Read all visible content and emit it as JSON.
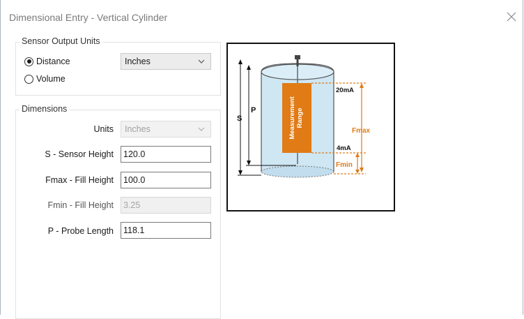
{
  "window": {
    "title": "Dimensional Entry - Vertical Cylinder"
  },
  "sensor_output": {
    "legend": "Sensor Output Units",
    "options": [
      {
        "label": "Distance",
        "checked": true
      },
      {
        "label": "Volume",
        "checked": false
      }
    ],
    "units_selected": "Inches"
  },
  "dimensions": {
    "legend": "Dimensions",
    "units_label": "Units",
    "units_selected": "Inches",
    "sensor_height": {
      "label": "S - Sensor Height",
      "value": "120.0"
    },
    "fill_height": {
      "label": "Fmax - Fill Height",
      "value": "100.0"
    },
    "fmin_height": {
      "label": "Fmin - Fill Height",
      "value": "3.25"
    },
    "probe_length": {
      "label": "P - Probe Length",
      "value": "118.1"
    }
  },
  "diagram": {
    "s_label": "S",
    "p_label": "P",
    "range_line1": "Measurement",
    "range_line2": "Range",
    "top_current": "20mA",
    "bottom_current": "4mA",
    "fmax_label": "Fmax",
    "fmin_label": "Fmin",
    "colors": {
      "range": "#e07b16",
      "tank_fill": "#cfe6f3",
      "tank_stroke": "#555555"
    }
  }
}
